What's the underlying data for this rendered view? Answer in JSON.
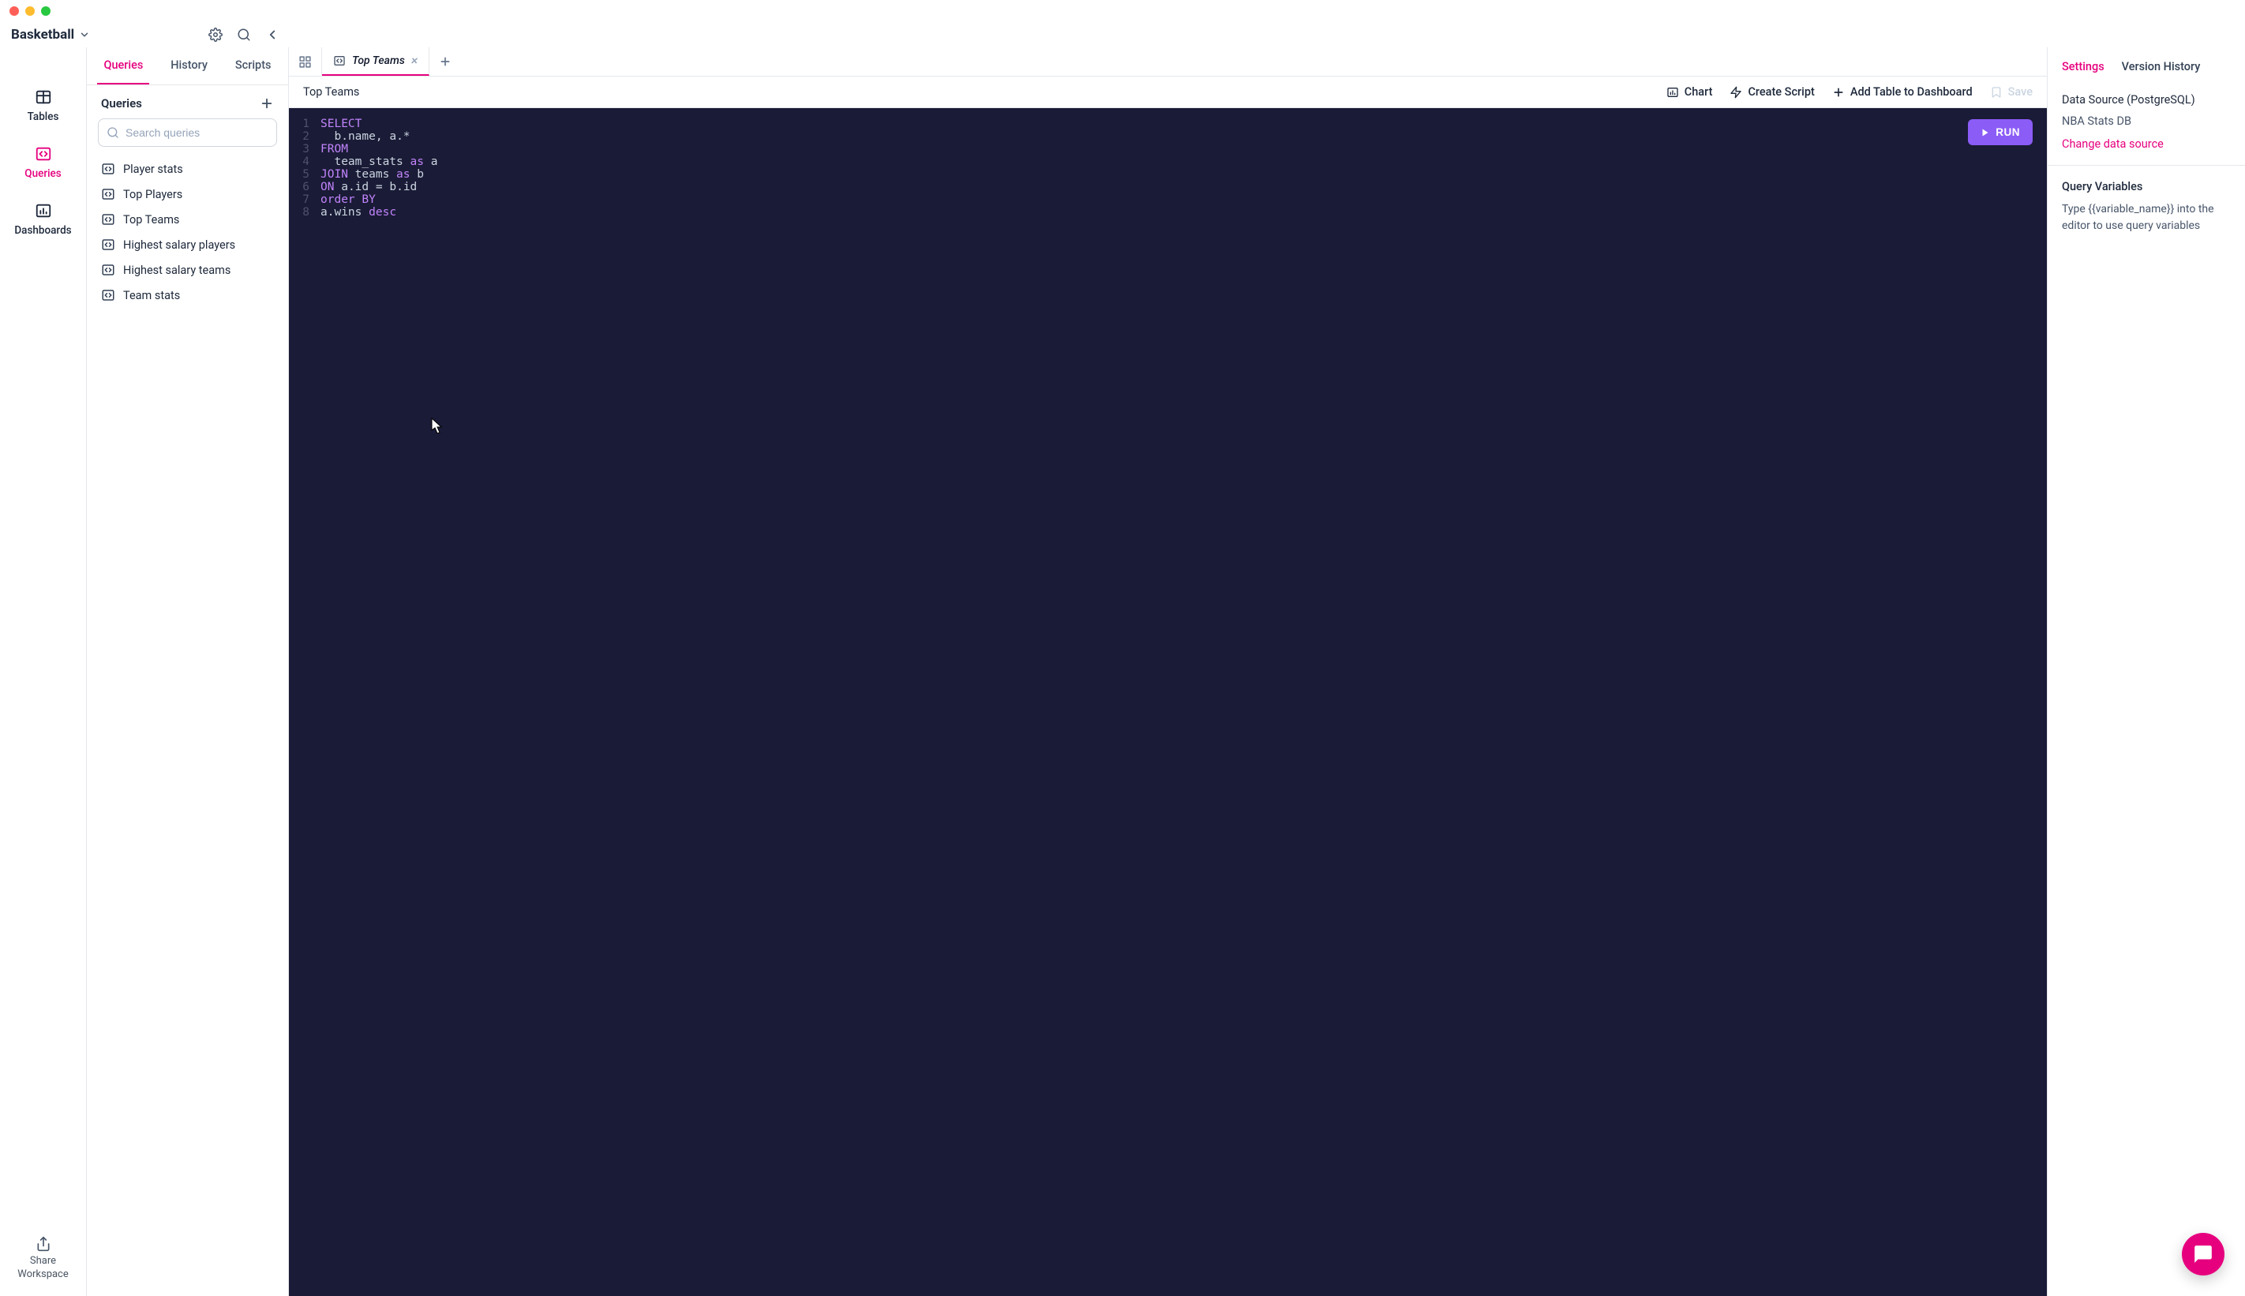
{
  "workspace": {
    "name": "Basketball"
  },
  "rail": {
    "tables": "Tables",
    "queries": "Queries",
    "dashboards": "Dashboards",
    "share": "Share Workspace"
  },
  "sidebar": {
    "tabs": {
      "queries": "Queries",
      "history": "History",
      "scripts": "Scripts"
    },
    "section_title": "Queries",
    "search_placeholder": "Search queries",
    "items": [
      {
        "label": "Player stats"
      },
      {
        "label": "Top Players"
      },
      {
        "label": "Top Teams"
      },
      {
        "label": "Highest salary players"
      },
      {
        "label": "Highest salary teams"
      },
      {
        "label": "Team stats"
      }
    ]
  },
  "tabs": {
    "active": {
      "label": "Top Teams"
    }
  },
  "toolbar": {
    "breadcrumb": "Top Teams",
    "chart": "Chart",
    "create_script": "Create Script",
    "add_table": "Add Table to Dashboard",
    "save": "Save",
    "run": "RUN"
  },
  "code": {
    "lines": [
      [
        {
          "t": "SELECT",
          "c": "kw"
        }
      ],
      [
        {
          "t": "  b",
          "c": "id"
        },
        {
          "t": ".",
          "c": "punct"
        },
        {
          "t": "name",
          "c": "id"
        },
        {
          "t": ", ",
          "c": "punct"
        },
        {
          "t": "a",
          "c": "id"
        },
        {
          "t": ".",
          "c": "punct"
        },
        {
          "t": "*",
          "c": "op"
        }
      ],
      [
        {
          "t": "FROM",
          "c": "kw"
        }
      ],
      [
        {
          "t": "  team_stats ",
          "c": "id"
        },
        {
          "t": "as",
          "c": "kw"
        },
        {
          "t": " a",
          "c": "id"
        }
      ],
      [
        {
          "t": "JOIN",
          "c": "kw"
        },
        {
          "t": " teams ",
          "c": "id"
        },
        {
          "t": "as",
          "c": "kw"
        },
        {
          "t": " b",
          "c": "id"
        }
      ],
      [
        {
          "t": "ON",
          "c": "kw"
        },
        {
          "t": " a",
          "c": "id"
        },
        {
          "t": ".",
          "c": "punct"
        },
        {
          "t": "id ",
          "c": "id"
        },
        {
          "t": "=",
          "c": "op"
        },
        {
          "t": " b",
          "c": "id"
        },
        {
          "t": ".",
          "c": "punct"
        },
        {
          "t": "id",
          "c": "id"
        }
      ],
      [
        {
          "t": "order ",
          "c": "kw"
        },
        {
          "t": "BY",
          "c": "kw"
        }
      ],
      [
        {
          "t": "a",
          "c": "id"
        },
        {
          "t": ".",
          "c": "punct"
        },
        {
          "t": "wins ",
          "c": "id"
        },
        {
          "t": "desc",
          "c": "kw"
        }
      ]
    ]
  },
  "right": {
    "tabs": {
      "settings": "Settings",
      "version": "Version History"
    },
    "ds_label": "Data Source (PostgreSQL)",
    "ds_value": "NBA Stats DB",
    "change": "Change data source",
    "qv_label": "Query Variables",
    "qv_help": "Type {{variable_name}} into the editor to use query variables"
  }
}
